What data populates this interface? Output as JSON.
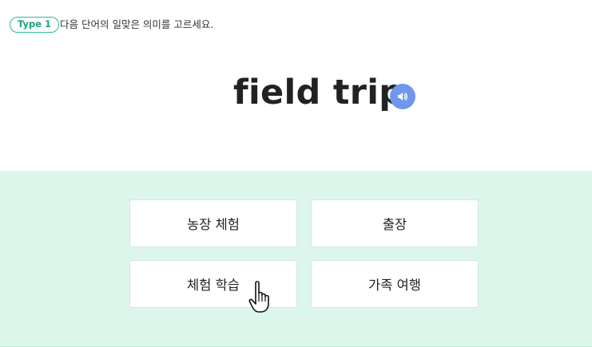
{
  "header": {
    "type_badge": "Type 1",
    "instruction": "다음 단어의 일맞은 의미를 고르세요."
  },
  "question": {
    "word": "field trip",
    "audio_icon": "speaker-icon"
  },
  "options": [
    {
      "label": "농장 체험"
    },
    {
      "label": "출장"
    },
    {
      "label": "체험 학습"
    },
    {
      "label": "가족 여행"
    }
  ],
  "colors": {
    "accent_green": "#2bb994",
    "answer_area_bg": "#dcf6ec",
    "audio_button": "#6f97ee"
  },
  "cursor_icon": "hand-pointer-icon"
}
